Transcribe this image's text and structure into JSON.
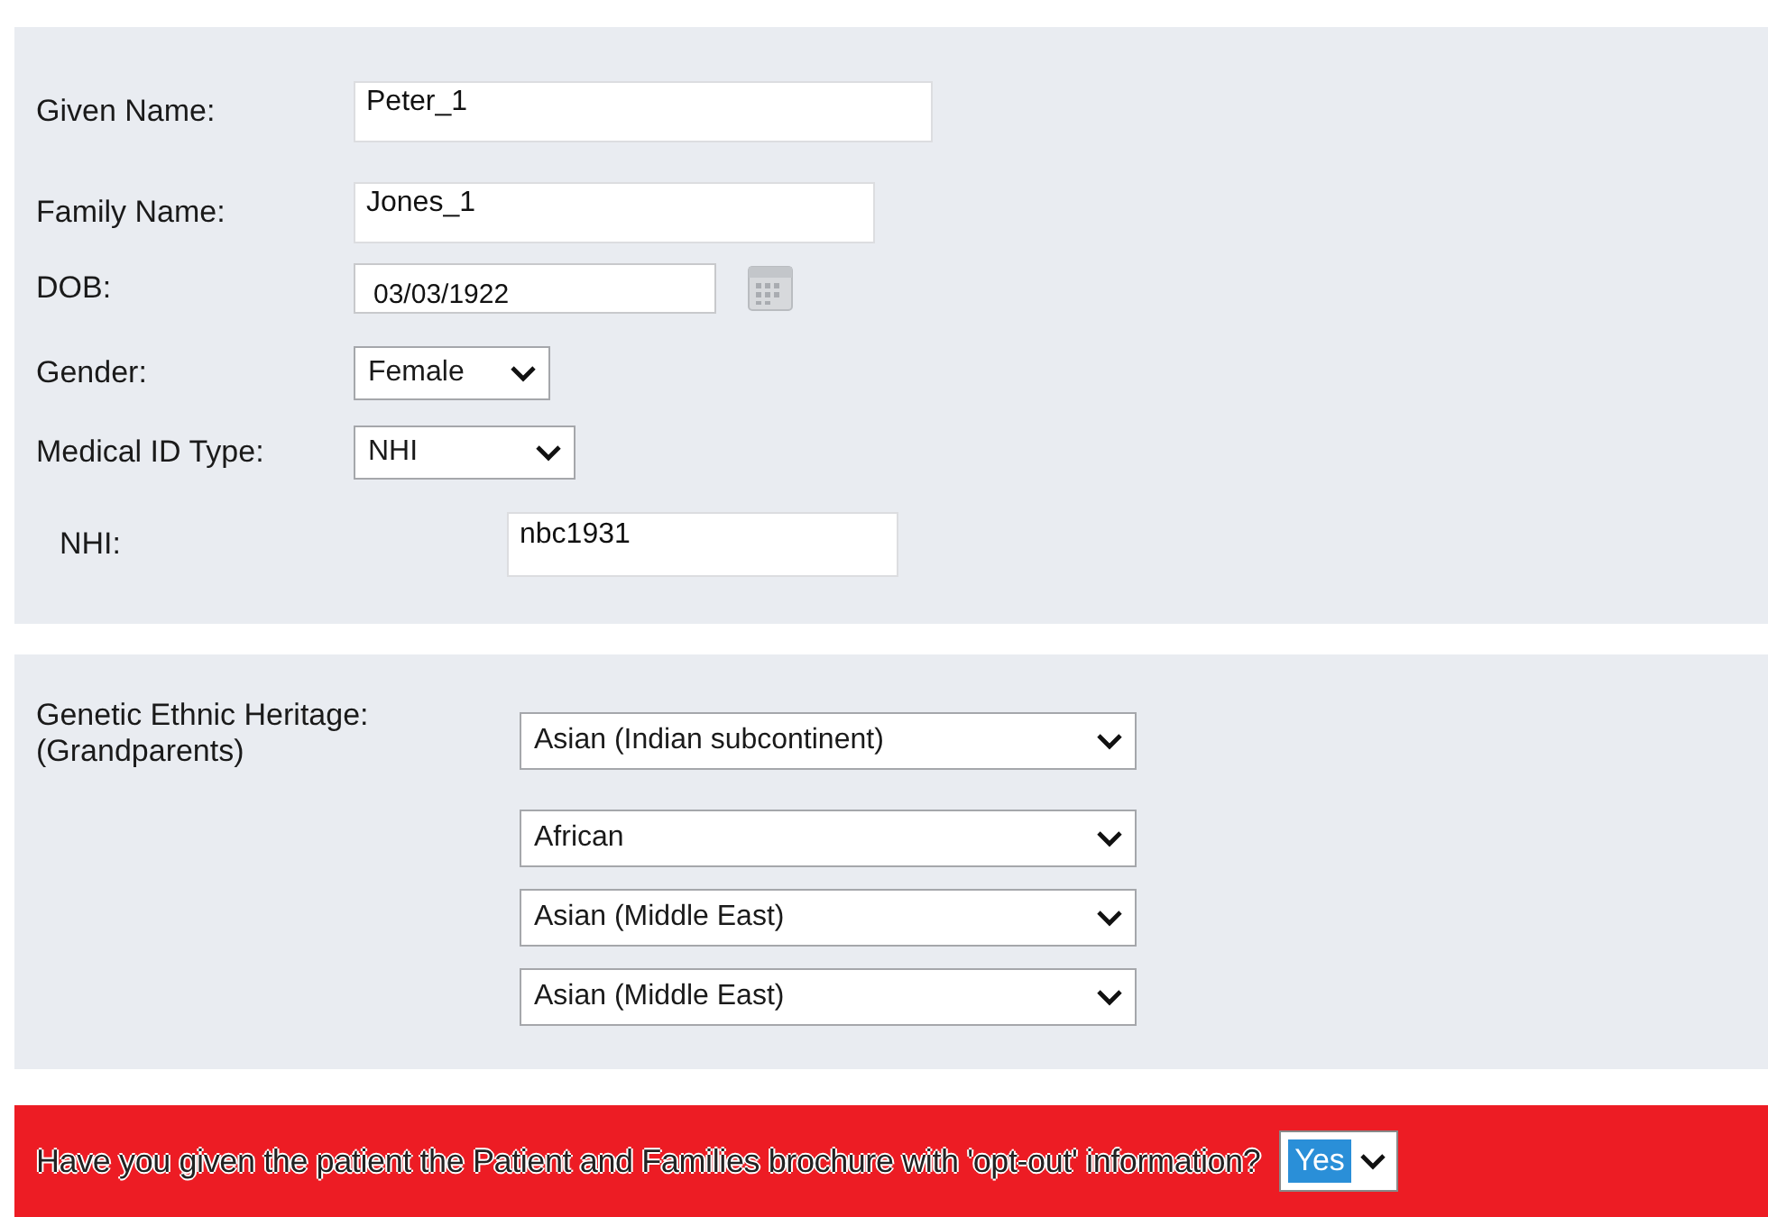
{
  "patient": {
    "fields": [
      {
        "kind": "text",
        "label": "Given Name:",
        "value": "Peter_1"
      },
      {
        "kind": "text",
        "label": "Family Name:",
        "value": "Jones_1"
      },
      {
        "kind": "date",
        "label": "DOB:",
        "value": "03/03/1922"
      },
      {
        "kind": "select",
        "label": "Gender:",
        "value": "Female"
      },
      {
        "kind": "select",
        "label": "Medical ID Type:",
        "value": "NHI"
      },
      {
        "kind": "text",
        "label": "NHI:",
        "value": "nbc1931"
      }
    ]
  },
  "heritage": {
    "label_lines": [
      "Genetic Ethnic Heritage:",
      "(Grandparents)"
    ],
    "selects": [
      "Asian (Indian subcontinent)",
      "African",
      "Asian (Middle East)",
      "Asian (Middle East)"
    ]
  },
  "brochure": {
    "question": "Have you given the patient the Patient and Families brochure with 'opt-out' information?",
    "answer": "Yes",
    "answer_highlighted": true
  }
}
